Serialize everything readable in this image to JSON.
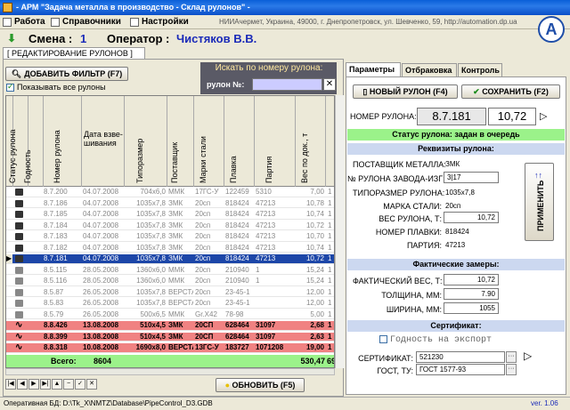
{
  "window": {
    "title": "- АРМ \"Задача металла в производство - Склад рулонов\" -"
  },
  "menu": {
    "items": [
      "Работа",
      "Справочники",
      "Настройки"
    ]
  },
  "address": "НИИАчермет, Украина, 49000, г. Днепропетровск, ул. Шевченко, 59,  http://automation.dp.ua",
  "shift": {
    "label": "Смена :",
    "value": "1",
    "operator_label": "Оператор :",
    "operator": "Чистяков В.В."
  },
  "doc_tab": "[ РЕДАКТИРОВАНИЕ РУЛОНОВ ]",
  "filter": {
    "add_label": "ДОБАВИТЬ ФИЛЬТР (F7)",
    "show_all": "Показывать все рулоны"
  },
  "search": {
    "title": "Искать по номеру рулона:",
    "label": "рулон №:",
    "value": ""
  },
  "grid": {
    "headers": [
      "Статус рулона",
      "Годность",
      "Номер рулона",
      "Дата взве-шивания",
      "Типоразмер",
      "Поставщик",
      "Марки стали",
      "Плавка",
      "Партия",
      "Вес по док., т"
    ],
    "rows": [
      [
        "8.7.200",
        "04.07.2008",
        "704x6,0",
        "ММК",
        "17ГС-У",
        "122459",
        "5310",
        "7,00",
        "1"
      ],
      [
        "8.7.186",
        "04.07.2008",
        "1035x7,8",
        "ЗМК",
        "20сп",
        "818424",
        "47213",
        "10,78",
        "1"
      ],
      [
        "8.7.185",
        "04.07.2008",
        "1035x7,8",
        "ЗМК",
        "20сп",
        "818424",
        "47213",
        "10,74",
        "1"
      ],
      [
        "8.7.184",
        "04.07.2008",
        "1035x7,8",
        "ЗМК",
        "20сп",
        "818424",
        "47213",
        "10,72",
        "1"
      ],
      [
        "8.7.183",
        "04.07.2008",
        "1035x7,8",
        "ЗМК",
        "20сп",
        "818424",
        "47213",
        "10,70",
        "1"
      ],
      [
        "8.7.182",
        "04.07.2008",
        "1035x7,8",
        "ЗМК",
        "20сп",
        "818424",
        "47213",
        "10,74",
        "1"
      ],
      [
        "8.7.181",
        "04.07.2008",
        "1035x7,8",
        "ЗМК",
        "20сп",
        "818424",
        "47213",
        "10,72",
        "1"
      ],
      [
        "8.5.115",
        "28.05.2008",
        "1360x6,0",
        "ММК",
        "20сп",
        "210940",
        "1",
        "15,24",
        "1"
      ],
      [
        "8.5.116",
        "28.05.2008",
        "1360x6,0",
        "ММК",
        "20сп",
        "210940",
        "1",
        "15,24",
        "1"
      ],
      [
        "8.5.87",
        "26.05.2008",
        "1035x7,8",
        "ВЕРСТА",
        "20сп",
        "23-45-1",
        "",
        "12,00",
        "1"
      ],
      [
        "8.5.83",
        "26.05.2008",
        "1035x7,8",
        "ВЕРСТА",
        "20сп",
        "23-45-1",
        "",
        "12,00",
        "1"
      ],
      [
        "8.5.79",
        "26.05.2008",
        "500x6,5",
        "ММК",
        "Gr.X42",
        "78-98",
        "",
        "5,00",
        "1"
      ],
      [
        "8.8.426",
        "13.08.2008",
        "510x4,5",
        "ЗМК",
        "20СП",
        "628464",
        "31097",
        "2,68",
        "1"
      ],
      [
        "8.8.399",
        "13.08.2008",
        "510x4,5",
        "ЗМК",
        "20СП",
        "628464",
        "31097",
        "2,63",
        "1"
      ],
      [
        "8.8.318",
        "10.08.2008",
        "1690x8,0",
        "ВЕРСТА",
        "13ГС-У",
        "183727",
        "1071208",
        "19,00",
        "1"
      ]
    ],
    "total_label": "Всего:",
    "total_count": "8604",
    "total_weight": "530,47",
    "total_extra": "69"
  },
  "refresh_label": "ОБНОВИТЬ (F5)",
  "right": {
    "tabs": [
      "Параметры",
      "Отбраковка",
      "Контроль"
    ],
    "new_roll": "НОВЫЙ РУЛОН (F4)",
    "save": "СОХРАНИТЬ (F2)",
    "roll_no_label": "НОМЕР РУЛОНА:",
    "roll_no": "8.7.181",
    "roll_weight": "10,72",
    "status": "Статус рулона: задан в очередь",
    "req_header": "Реквизиты рулона:",
    "supplier_label": "ПОСТАВЩИК МЕТАЛЛА:",
    "supplier": "ЗМК",
    "plant_no_label": "№ РУЛОНА ЗАВОДА-ИЗГ:",
    "plant_no": "3|17",
    "size_label": "ТИПОРАЗМЕР РУЛОНА:",
    "size": "1035x7,8",
    "steel_label": "МАРКА СТАЛИ:",
    "steel": "20сп",
    "weight_label": "ВЕС РУЛОНА, Т:",
    "weight": "10,72",
    "heat_label": "НОМЕР ПЛАВКИ:",
    "heat": "818424",
    "lot_label": "ПАРТИЯ:",
    "lot": "47213",
    "apply": "ПРИМЕНИТЬ",
    "meas_header": "Фактические замеры:",
    "fact_weight_label": "ФАКТИЧЕСКИЙ ВЕС, Т:",
    "fact_weight": "10,72",
    "thickness_label": "ТОЛЩИНА, ММ:",
    "thickness": "7.90",
    "width_label": "ШИРИНА, ММ:",
    "width": "1055",
    "cert_header": "Сертификат:",
    "export_label": "Годность на экспорт",
    "cert_label": "СЕРТИФИКАТ:",
    "cert": "521230",
    "gost_label": "ГОСТ, ТУ:",
    "gost": "ГОСТ 1577-93"
  },
  "statusbar": {
    "db": "Оперативная БД:  D:\\Tk_X\\NMTZ\\Database\\PipeControl_D3.GDB",
    "version": "ver. 1.06"
  }
}
